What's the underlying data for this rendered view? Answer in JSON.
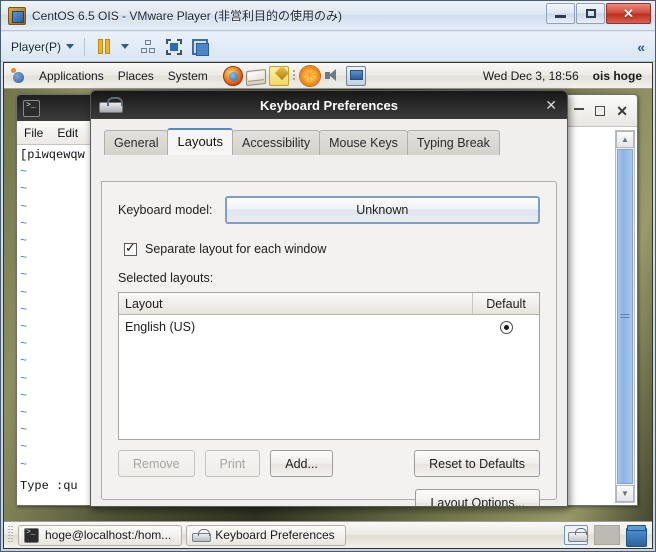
{
  "host_window": {
    "title": "CentOS 6.5 OIS - VMware Player (非営利目的の使用のみ)",
    "icon": "vmware-icon",
    "buttons": {
      "minimize": "minimize-icon",
      "restore": "restore-icon",
      "close": "✕"
    }
  },
  "vm_toolbar": {
    "player_menu": "Player(P)",
    "icons": [
      "pause-icon",
      "removable-devices-icon",
      "fullscreen-icon",
      "unity-icon"
    ],
    "collapse": "«"
  },
  "gnome_panel": {
    "foot_icon": "gnome-foot-icon",
    "menus": [
      "Applications",
      "Places",
      "System"
    ],
    "launchers": [
      "firefox-icon",
      "evolution-mail-icon",
      "text-editor-icon"
    ],
    "tray": [
      "brightness-sun-icon",
      "volume-icon",
      "network-display-icon"
    ],
    "clock": "Wed Dec  3, 18:56",
    "user": "ois hoge"
  },
  "terminal_window": {
    "icon": "terminal-icon",
    "menus": [
      "File",
      "Edit"
    ],
    "first_line": "[piwqewqw",
    "tilde": "~",
    "tilde_count": 18,
    "status_line": "Type  :qu"
  },
  "background_window": {
    "buttons": {
      "minimize": "minimize-icon",
      "maximize": "maximize-icon",
      "close": "✕"
    },
    "scrollbar": {
      "up": "▲",
      "down": "▼",
      "grip": "scrollbar-grip"
    }
  },
  "dialog": {
    "title": "Keyboard Preferences",
    "icon": "keyboard-icon",
    "close": "✕",
    "tabs": [
      {
        "label": "General",
        "active": false
      },
      {
        "label": "Layouts",
        "active": true
      },
      {
        "label": "Accessibility",
        "active": false
      },
      {
        "label": "Mouse Keys",
        "active": false
      },
      {
        "label": "Typing Break",
        "active": false
      }
    ],
    "model_label": "Keyboard model:",
    "model_value": "Unknown",
    "separate_layout_label": "Separate layout for each window",
    "separate_layout_checked": true,
    "selected_layouts_label": "Selected layouts:",
    "list": {
      "columns": [
        "Layout",
        "Default"
      ],
      "rows": [
        {
          "layout": "English (US)",
          "default": true
        }
      ]
    },
    "buttons": {
      "remove": "Remove",
      "print": "Print",
      "add": "Add...",
      "reset": "Reset to Defaults",
      "layout_options": "Layout Options..."
    }
  },
  "taskbar": {
    "items": [
      {
        "label": "hoge@localhost:/hom...",
        "icon": "terminal-icon"
      },
      {
        "label": "Keyboard Preferences",
        "icon": "keyboard-icon"
      }
    ],
    "tray": [
      "keyboard-indicator-icon",
      "tray-blank",
      "trash-icon"
    ]
  },
  "colors": {
    "accent_blue": "#5a8ac6",
    "dialog_bg": "#f0efed",
    "titlebar_dark": "#2c2c2c",
    "scrollbar_blue": "#8fb4e2",
    "close_red": "#d4493a"
  }
}
